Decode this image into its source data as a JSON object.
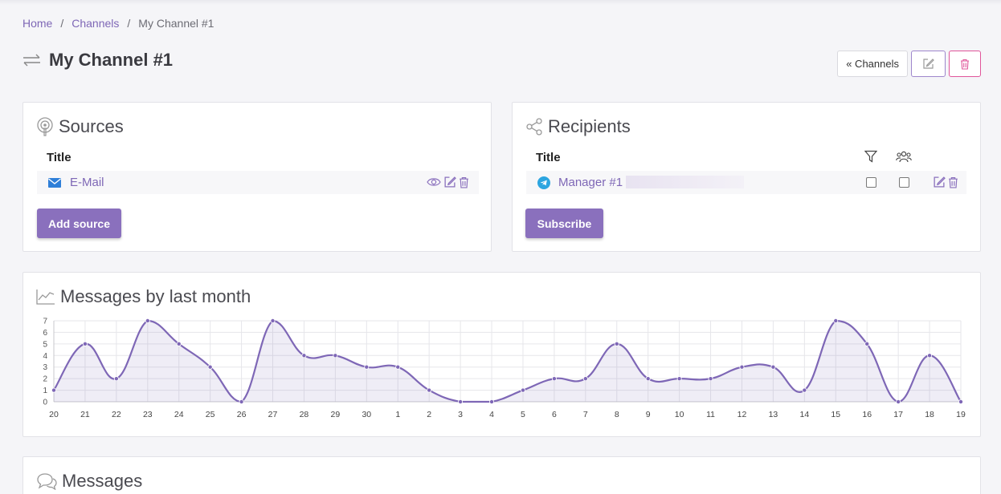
{
  "breadcrumb": {
    "home": "Home",
    "channels": "Channels",
    "current": "My Channel #1",
    "sep": "/"
  },
  "page_title": "My Channel #1",
  "toolbar": {
    "back_label": "« Channels"
  },
  "sources": {
    "title": "Sources",
    "col_title": "Title",
    "items": [
      {
        "label": "E-Mail",
        "icon": "mail-icon"
      }
    ],
    "add_button": "Add source"
  },
  "recipients": {
    "title": "Recipients",
    "col_title": "Title",
    "items": [
      {
        "label": "Manager #1",
        "icon": "telegram-icon",
        "filter_checked": false,
        "group_checked": false
      }
    ],
    "subscribe_button": "Subscribe"
  },
  "chart_section": {
    "title": "Messages by last month"
  },
  "chart_data": {
    "type": "area",
    "categories": [
      "20",
      "21",
      "22",
      "23",
      "24",
      "25",
      "26",
      "27",
      "28",
      "29",
      "30",
      "1",
      "2",
      "3",
      "4",
      "5",
      "6",
      "7",
      "8",
      "9",
      "10",
      "11",
      "12",
      "13",
      "14",
      "15",
      "16",
      "17",
      "18",
      "19"
    ],
    "values": [
      1,
      5,
      2,
      7,
      5,
      3,
      0,
      7,
      4,
      4,
      3,
      3,
      1,
      0,
      0,
      1,
      2,
      2,
      5,
      2,
      2,
      2,
      3,
      3,
      1,
      7,
      5,
      0,
      4,
      0
    ],
    "ylim": [
      0,
      7
    ],
    "yticks": [
      "0",
      "1",
      "2",
      "3",
      "4",
      "5",
      "6",
      "7"
    ],
    "grid": true,
    "color": "#7e67b6"
  },
  "messages_section": {
    "title": "Messages"
  },
  "colors": {
    "accent": "#8a70bd",
    "link": "#7e67b6",
    "danger": "#e0559a"
  }
}
